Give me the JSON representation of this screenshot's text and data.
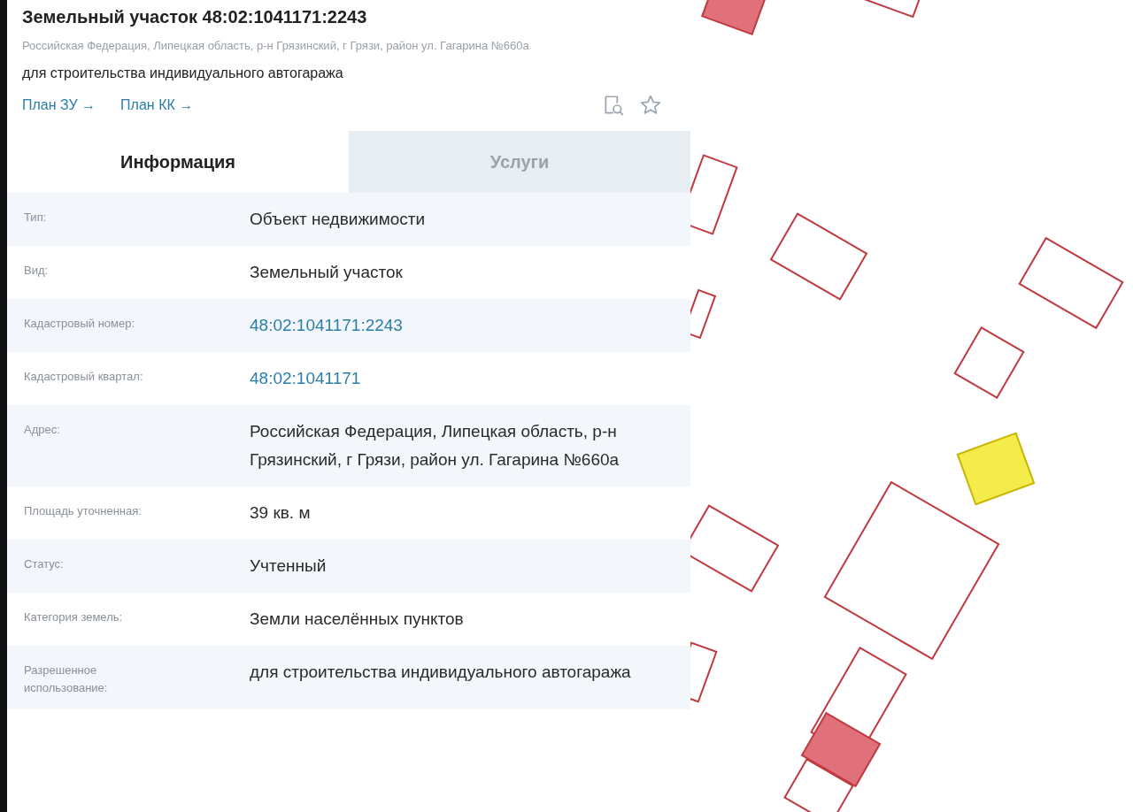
{
  "header": {
    "title": "Земельный участок 48:02:1041171:2243",
    "address": "Российская Федерация, Липецкая область, р-н Грязинский, г Грязи, район ул. Гагарина №660а",
    "purpose": "для строительства индивидуального автогаража",
    "links": [
      "План ЗУ →",
      "План КК →"
    ]
  },
  "tabs": [
    {
      "label": "Информация",
      "selected": true
    },
    {
      "label": "Услуги",
      "selected": false
    }
  ],
  "rows": [
    {
      "label": "Тип:",
      "value": "Объект недвижимости",
      "kind": "text"
    },
    {
      "label": "Вид:",
      "value": "Земельный участок",
      "kind": "text"
    },
    {
      "label": "Кадастровый номер:",
      "value": "48:02:1041171:2243",
      "kind": "link"
    },
    {
      "label": "Кадастровый квартал:",
      "value": "48:02:1041171",
      "kind": "link"
    },
    {
      "label": "Адрес:",
      "value": "Российская Федерация, Липецкая область, р-н Грязинский, г Грязи, район ул. Гагарина №660а",
      "kind": "text"
    },
    {
      "label": "Площадь уточненная:",
      "value": "39 кв. м",
      "kind": "text"
    },
    {
      "label": "Статус:",
      "value": "Учтенный",
      "kind": "text"
    },
    {
      "label": "Категория земель:",
      "value": "Земли населённых пунктов",
      "kind": "text"
    },
    {
      "label": "Разрешенное использование:",
      "value": "для строительства индивидуального автогаража",
      "kind": "text"
    }
  ]
}
